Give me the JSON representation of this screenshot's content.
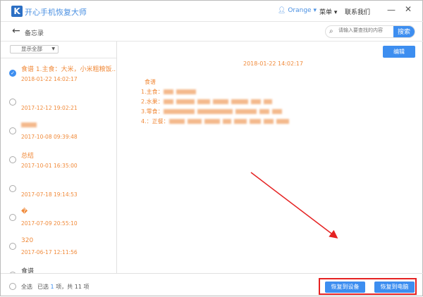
{
  "app": {
    "logo": "K",
    "title": "开心手机恢复大师",
    "user": "Orange",
    "menu": "菜单",
    "contact": "联系我们",
    "minimize": "—",
    "close": "✕"
  },
  "toolbar": {
    "back": "←",
    "title": "备忘录",
    "search_placeholder": "请输入要查找的内容",
    "search_button": "搜索"
  },
  "filter": {
    "selected": "显示全部"
  },
  "notes": [
    {
      "title": "食谱 1.主食：大米，小米粗粮饭...",
      "date": "2018-01-22 14:02:17",
      "checked": true,
      "blurred": false
    },
    {
      "title": "",
      "date": "2017-12-12 19:02:21",
      "checked": false,
      "blurred": false
    },
    {
      "title": "",
      "date": "2017-10-08 09:39:48",
      "checked": false,
      "blurred": true
    },
    {
      "title": "总结",
      "date": "2017-10-01 16:35:00",
      "checked": false,
      "blurred": false
    },
    {
      "title": "",
      "date": "2017-07-18 19:14:53",
      "checked": false,
      "blurred": false
    },
    {
      "title": "�",
      "date": "2017-07-09 20:55:10",
      "checked": false,
      "blurred": false
    },
    {
      "title": "320",
      "date": "2017-06-17 12:11:56",
      "checked": false,
      "blurred": false
    },
    {
      "title": "食谱",
      "date": "",
      "checked": false,
      "blurred": false
    }
  ],
  "detail": {
    "edit": "编辑",
    "date": "2018-01-22 14:02:17",
    "lines": [
      "食谱",
      "1.主食：",
      "2.水果：",
      "3.零食：",
      "4.：正餐："
    ]
  },
  "bottom": {
    "select_all": "全选",
    "selected_prefix": "已选",
    "selected_count": "1",
    "selected_mid": "项，共",
    "total": "11",
    "selected_suffix": "项",
    "restore_device": "恢复到设备",
    "restore_pc": "恢复到电脑"
  },
  "colors": {
    "accent": "#3d8ef0",
    "orange": "#f08a3a",
    "highlight": "#e52222"
  }
}
